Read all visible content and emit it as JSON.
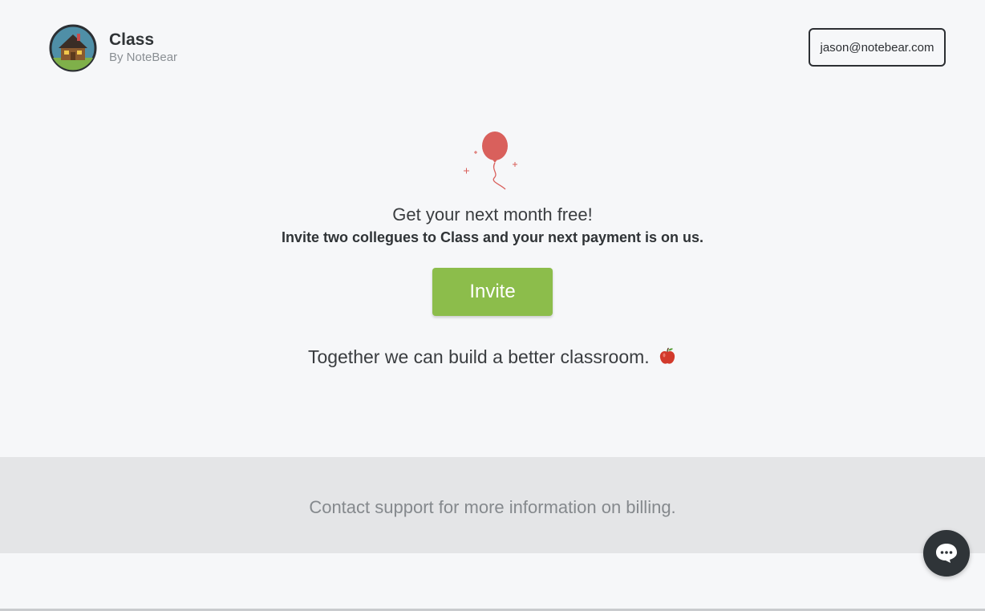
{
  "brand": {
    "title": "Class",
    "subtitle": "By NoteBear",
    "logo_icon": "house-logo-icon"
  },
  "account": {
    "email": "jason@notebear.com"
  },
  "promo": {
    "illustration_icon": "balloon-icon",
    "headline": "Get your next month free!",
    "subline": "Invite two collegues to Class and your next payment is on us.",
    "invite_label": "Invite",
    "tagline": "Together we can build a better classroom.",
    "tagline_emoji_icon": "apple-icon"
  },
  "footer": {
    "support_text": "Contact support for more information on billing."
  },
  "chat": {
    "icon": "chat-bubble-icon"
  },
  "colors": {
    "accent_green": "#8cbd4b",
    "balloon_red": "#d9605c",
    "background": "#f6f7f9",
    "footer_band": "#e4e5e7",
    "chat_button": "#2f3438"
  }
}
